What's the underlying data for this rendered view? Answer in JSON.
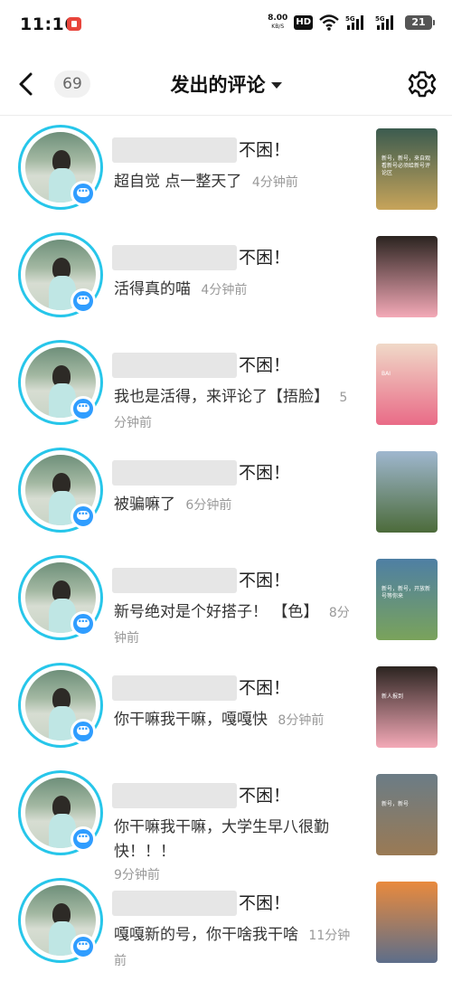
{
  "status_bar": {
    "time": "11:16",
    "speed_value": "8.00",
    "speed_unit": "KB/S",
    "hd": "HD",
    "battery": "21"
  },
  "header": {
    "back_icon": "chevron-left-icon",
    "count": "69",
    "title": "发出的评论",
    "settings_icon": "gear-icon"
  },
  "colors": {
    "ring": "#27c6ea",
    "badge": "#2f9dff",
    "text_secondary": "#999999"
  },
  "comments": [
    {
      "post_title": "不困！",
      "text": "超自觉 点一整天了",
      "time": "4分钟前",
      "thumb_caption": "新号，新号，来自观看新号必须给新号评论区",
      "thumb_colors": [
        "#3b5b4f",
        "#c7a45a"
      ]
    },
    {
      "post_title": "不困！",
      "text": "活得真的喵",
      "time": "4分钟前",
      "thumb_caption": "",
      "thumb_colors": [
        "#2b2420",
        "#f4a9b7"
      ]
    },
    {
      "post_title": "不困！",
      "text": "我也是活得，来评论了【捂脸】",
      "time": "5分钟前",
      "thumb_caption": "BAI",
      "thumb_colors": [
        "#f0d9c8",
        "#e96b87"
      ]
    },
    {
      "post_title": "不困！",
      "text": "被骗嘛了",
      "time": "6分钟前",
      "thumb_caption": "",
      "thumb_colors": [
        "#9fb7cf",
        "#4c6b3a"
      ]
    },
    {
      "post_title": "不困！",
      "text": "新号绝对是个好搭子！ 【色】",
      "time": "8分钟前",
      "thumb_caption": "新号，新号，开放新号等你来",
      "thumb_colors": [
        "#4e7fa4",
        "#7aa35b"
      ]
    },
    {
      "post_title": "不困！",
      "text": "你干嘛我干嘛，嘎嘎快",
      "time": "8分钟前",
      "thumb_caption": "新人报到",
      "thumb_colors": [
        "#2b2420",
        "#f4a9b7"
      ]
    },
    {
      "post_title": "不困！",
      "text": "你干嘛我干嘛，大学生早八很勤快！！！",
      "time": "9分钟前",
      "thumb_caption": "新号，新号",
      "thumb_colors": [
        "#6b7c86",
        "#9a7a54"
      ]
    },
    {
      "post_title": "不困！",
      "text": "嘎嘎新的号，你干啥我干啥",
      "time": "11分钟前",
      "thumb_caption": "",
      "thumb_colors": [
        "#e98a3d",
        "#5d6e8a"
      ]
    }
  ]
}
